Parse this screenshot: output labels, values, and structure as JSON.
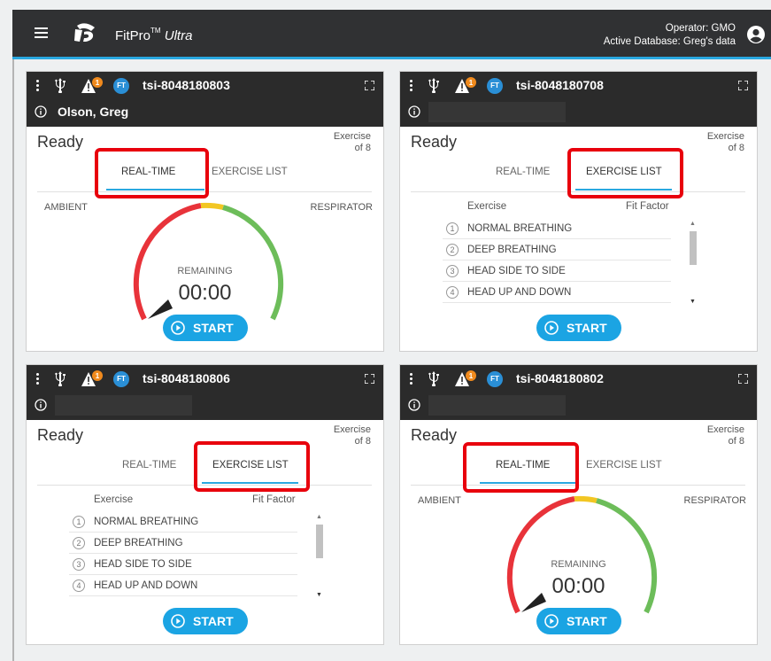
{
  "header": {
    "brand_name": "FitPro",
    "brand_tm": "TM",
    "brand_suffix": "Ultra",
    "operator_line": "Operator:  GMO",
    "database_line": "Active Database:  Greg's data",
    "icons": {
      "menu": "hamburger-icon",
      "logo": "tsi-logo-icon",
      "user": "account-circle-icon"
    }
  },
  "panels": [
    {
      "device_id": "tsi-8048180803",
      "person": "Olson, Greg",
      "warning_count": "1",
      "ft_badge": "FT",
      "status": "Ready",
      "exercise_label": "Exercise",
      "exercise_of": "of 8",
      "active_tab": "REAL-TIME",
      "remaining_label": "REMAINING",
      "timer": "00:00"
    },
    {
      "device_id": "tsi-8048180708",
      "person": "",
      "warning_count": "1",
      "ft_badge": "FT",
      "status": "Ready",
      "exercise_label": "Exercise",
      "exercise_of": "of 8",
      "active_tab": "EXERCISE LIST"
    },
    {
      "device_id": "tsi-8048180806",
      "person": "",
      "warning_count": "1",
      "ft_badge": "FT",
      "status": "Ready",
      "exercise_label": "Exercise",
      "exercise_of": "of 8",
      "active_tab": "EXERCISE LIST"
    },
    {
      "device_id": "tsi-8048180802",
      "person": "",
      "warning_count": "1",
      "ft_badge": "FT",
      "status": "Ready",
      "exercise_label": "Exercise",
      "exercise_of": "of 8",
      "active_tab": "REAL-TIME",
      "remaining_label": "REMAINING",
      "timer": "00:00"
    }
  ],
  "tabs": {
    "realtime": "REAL-TIME",
    "exercise_list": "EXERCISE LIST"
  },
  "labels": {
    "ambient": "AMBIENT",
    "respirator": "RESPIRATOR",
    "start": "START"
  },
  "exercise_list": {
    "col_exercise": "Exercise",
    "col_fit_factor": "Fit Factor",
    "items": [
      {
        "num": "1",
        "name": "NORMAL BREATHING"
      },
      {
        "num": "2",
        "name": "DEEP BREATHING"
      },
      {
        "num": "3",
        "name": "HEAD SIDE TO SIDE"
      },
      {
        "num": "4",
        "name": "HEAD UP AND DOWN"
      }
    ]
  },
  "colors": {
    "accent": "#1ba4e3",
    "header_bg": "#303133",
    "panel_header_bg": "#2b2b2b",
    "highlight_box": "#e8000c",
    "gauge_red": "#e8333a",
    "gauge_yellow": "#f2c623",
    "gauge_green": "#6dbd5a",
    "warning_badge": "#f08a1d"
  }
}
